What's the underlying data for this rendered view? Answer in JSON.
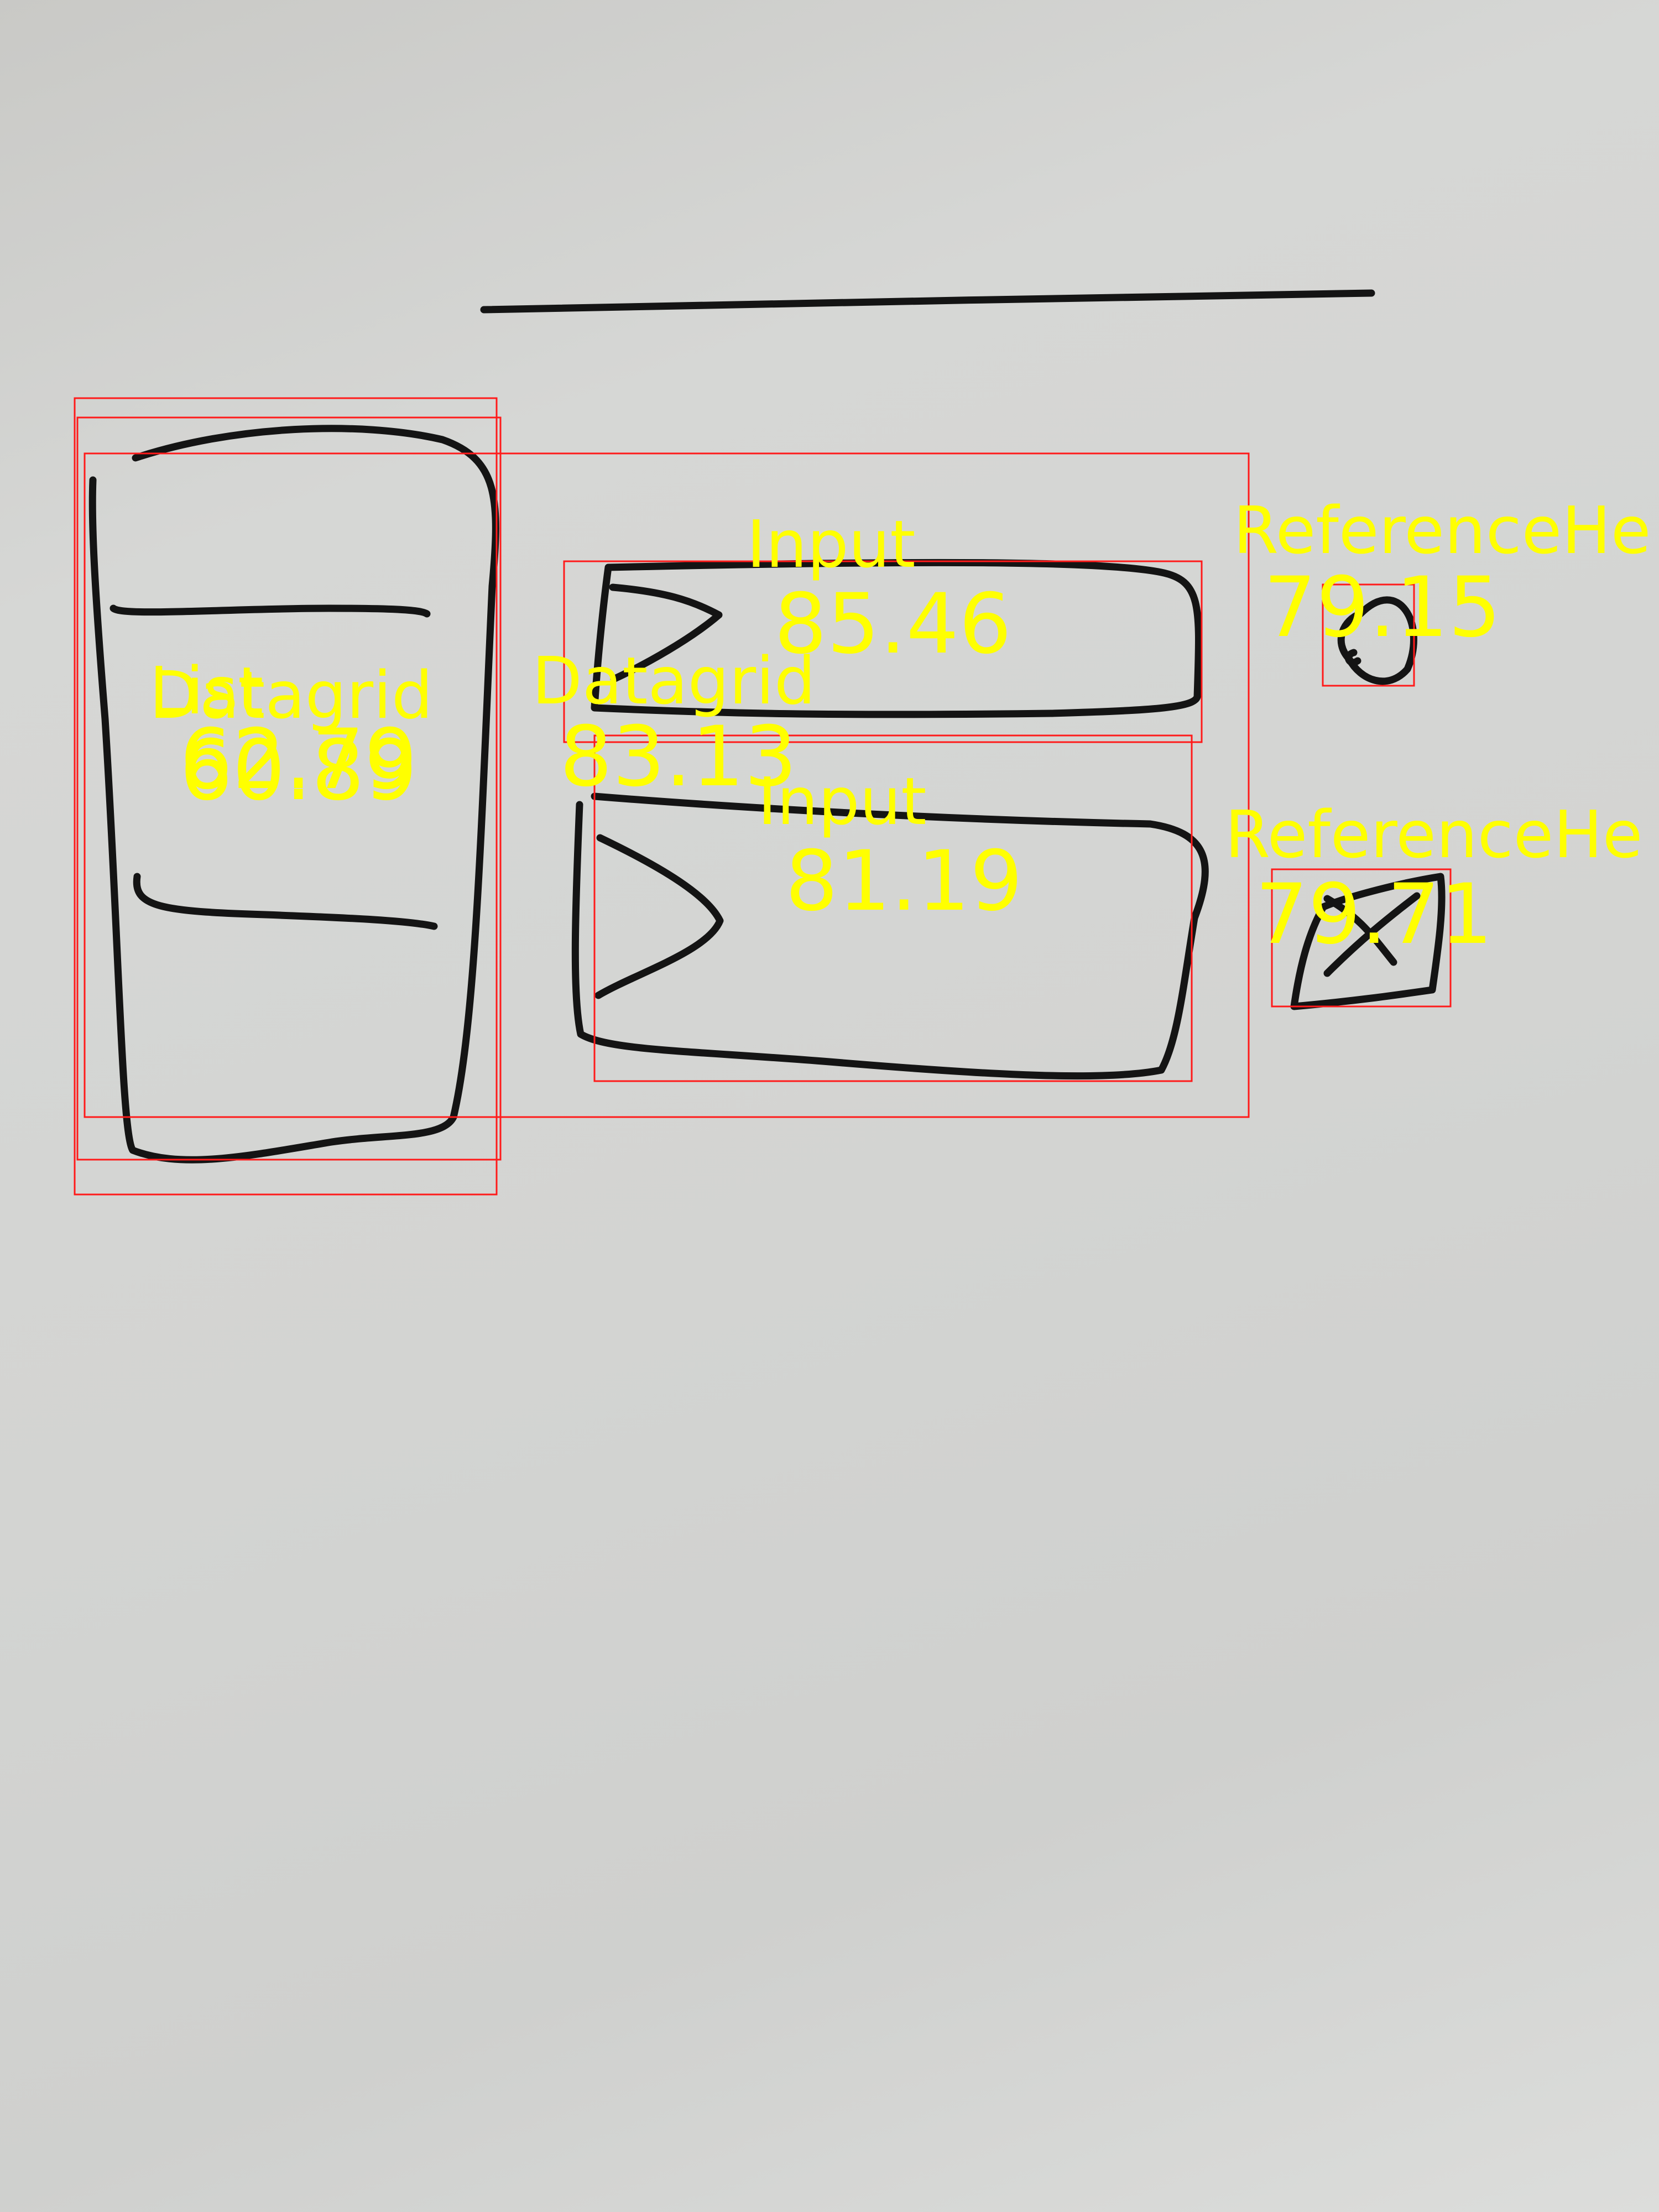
{
  "detections": [
    {
      "label": "List",
      "score": "60.89"
    },
    {
      "label": "Datagrid",
      "score": "62.79"
    },
    {
      "label": "Datagrid",
      "score": "83.13"
    },
    {
      "label": "Input",
      "score": "85.46"
    },
    {
      "label": "Input",
      "score": "81.19"
    },
    {
      "label": "ReferenceHe",
      "score": "79.15"
    },
    {
      "label": "ReferenceHe",
      "score": "79.71"
    }
  ],
  "colors": {
    "box": "#ff1a1a",
    "text": "#ffff00",
    "ink": "#141414",
    "whiteboard": "#d4d5d3"
  }
}
